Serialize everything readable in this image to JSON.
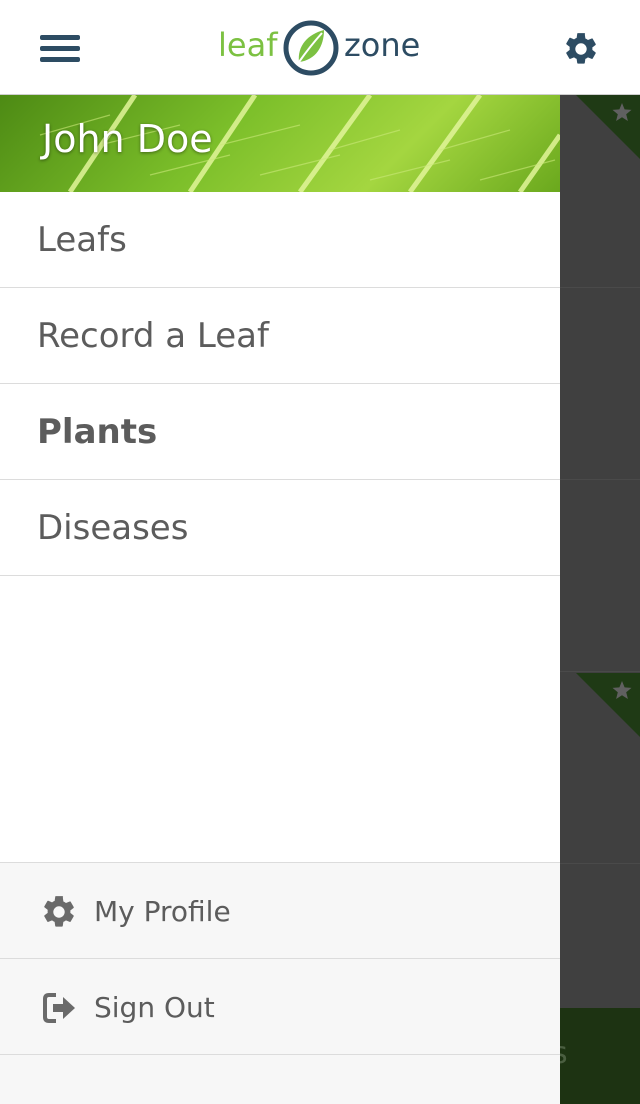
{
  "app": {
    "logo_left": "leaf",
    "logo_right": "zone"
  },
  "icons": {
    "menu": "hamburger-icon",
    "settings": "gear-icon",
    "profile": "gear-icon",
    "signout": "sign-out-icon",
    "favorite": "star-icon"
  },
  "colors": {
    "brand_green": "#7cc142",
    "brand_navy": "#2d4c63",
    "text": "#5c5c5c",
    "overlay": "#404040"
  },
  "drawer": {
    "user_name": "John Doe",
    "items": [
      {
        "label": "Leafs",
        "active": false
      },
      {
        "label": "Record a Leaf",
        "active": false
      },
      {
        "label": "Plants",
        "active": true
      },
      {
        "label": "Diseases",
        "active": false
      }
    ],
    "footer": [
      {
        "label": "My Profile",
        "icon": "gear-icon"
      },
      {
        "label": "Sign Out",
        "icon": "sign-out-icon"
      }
    ]
  },
  "background": {
    "bottom_bar_partial_text": "s"
  }
}
